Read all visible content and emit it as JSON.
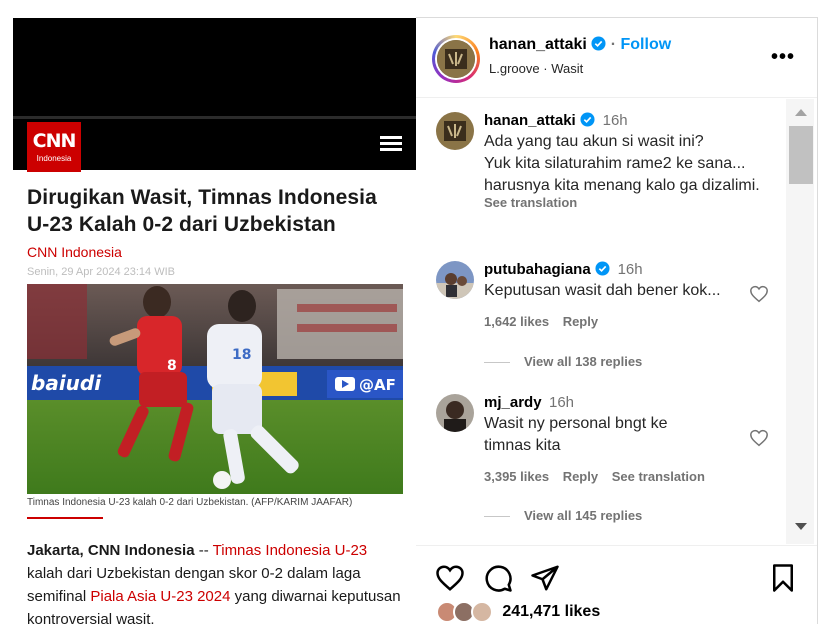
{
  "article": {
    "brand_logo": "CNN",
    "brand_sub": "Indonesia",
    "headline": "Dirugikan Wasit, Timnas Indonesia U-23 Kalah 0-2 dari Uzbekistan",
    "byline": "CNN Indonesia",
    "date": "Senin, 29 Apr 2024 23:14 WIB",
    "caption": "Timnas Indonesia U-23 kalah 0-2 dari Uzbekistan. (AFP/KARIM JAAFAR)",
    "body": {
      "lead_bold": "Jakarta, CNN Indonesia",
      "sep": " -- ",
      "link1": "Timnas Indonesia U-23",
      "text1": " kalah dari Uzbekistan dengan skor 0-2 dalam laga semifinal ",
      "link2": "Piala Asia U-23 2024",
      "text2": " yang diwarnai keputusan kontroversial wasit."
    },
    "photo": {
      "board_text": "baiudi",
      "ad_text": "@AF",
      "player1_number": "8",
      "player2_number": "18"
    }
  },
  "header": {
    "username": "hanan_attaki",
    "separator": "·",
    "follow": "Follow",
    "audio": "L.groove",
    "sub_sep": "·",
    "location": "Wasit",
    "more": "•••"
  },
  "comments": [
    {
      "username": "hanan_attaki",
      "time": "16h",
      "text": "Ada yang tau akun si wasit ini?\nYuk kita silaturahim rame2 ke sana...\nharusnya kita menang kalo ga dizalimi.",
      "see_translation": "See translation"
    },
    {
      "username": "putubahagiana",
      "time": "16h",
      "text": "Keputusan wasit dah bener kok...",
      "likes": "1,642 likes",
      "reply": "Reply",
      "view_replies": "View all 138 replies"
    },
    {
      "username": "mj_ardy",
      "time": "16h",
      "text": "Wasit ny personal bngt ke timnas kita",
      "likes": "3,395 likes",
      "reply": "Reply",
      "see_translation": "See translation",
      "view_replies": "View all 145 replies"
    }
  ],
  "actions": {
    "likes": "241,471 likes",
    "icons": [
      "heart-icon",
      "comment-icon",
      "share-icon",
      "bookmark-icon"
    ]
  },
  "colors": {
    "accent_blue": "#0095f6",
    "cnn_red": "#cc0000",
    "muted": "#737373"
  }
}
